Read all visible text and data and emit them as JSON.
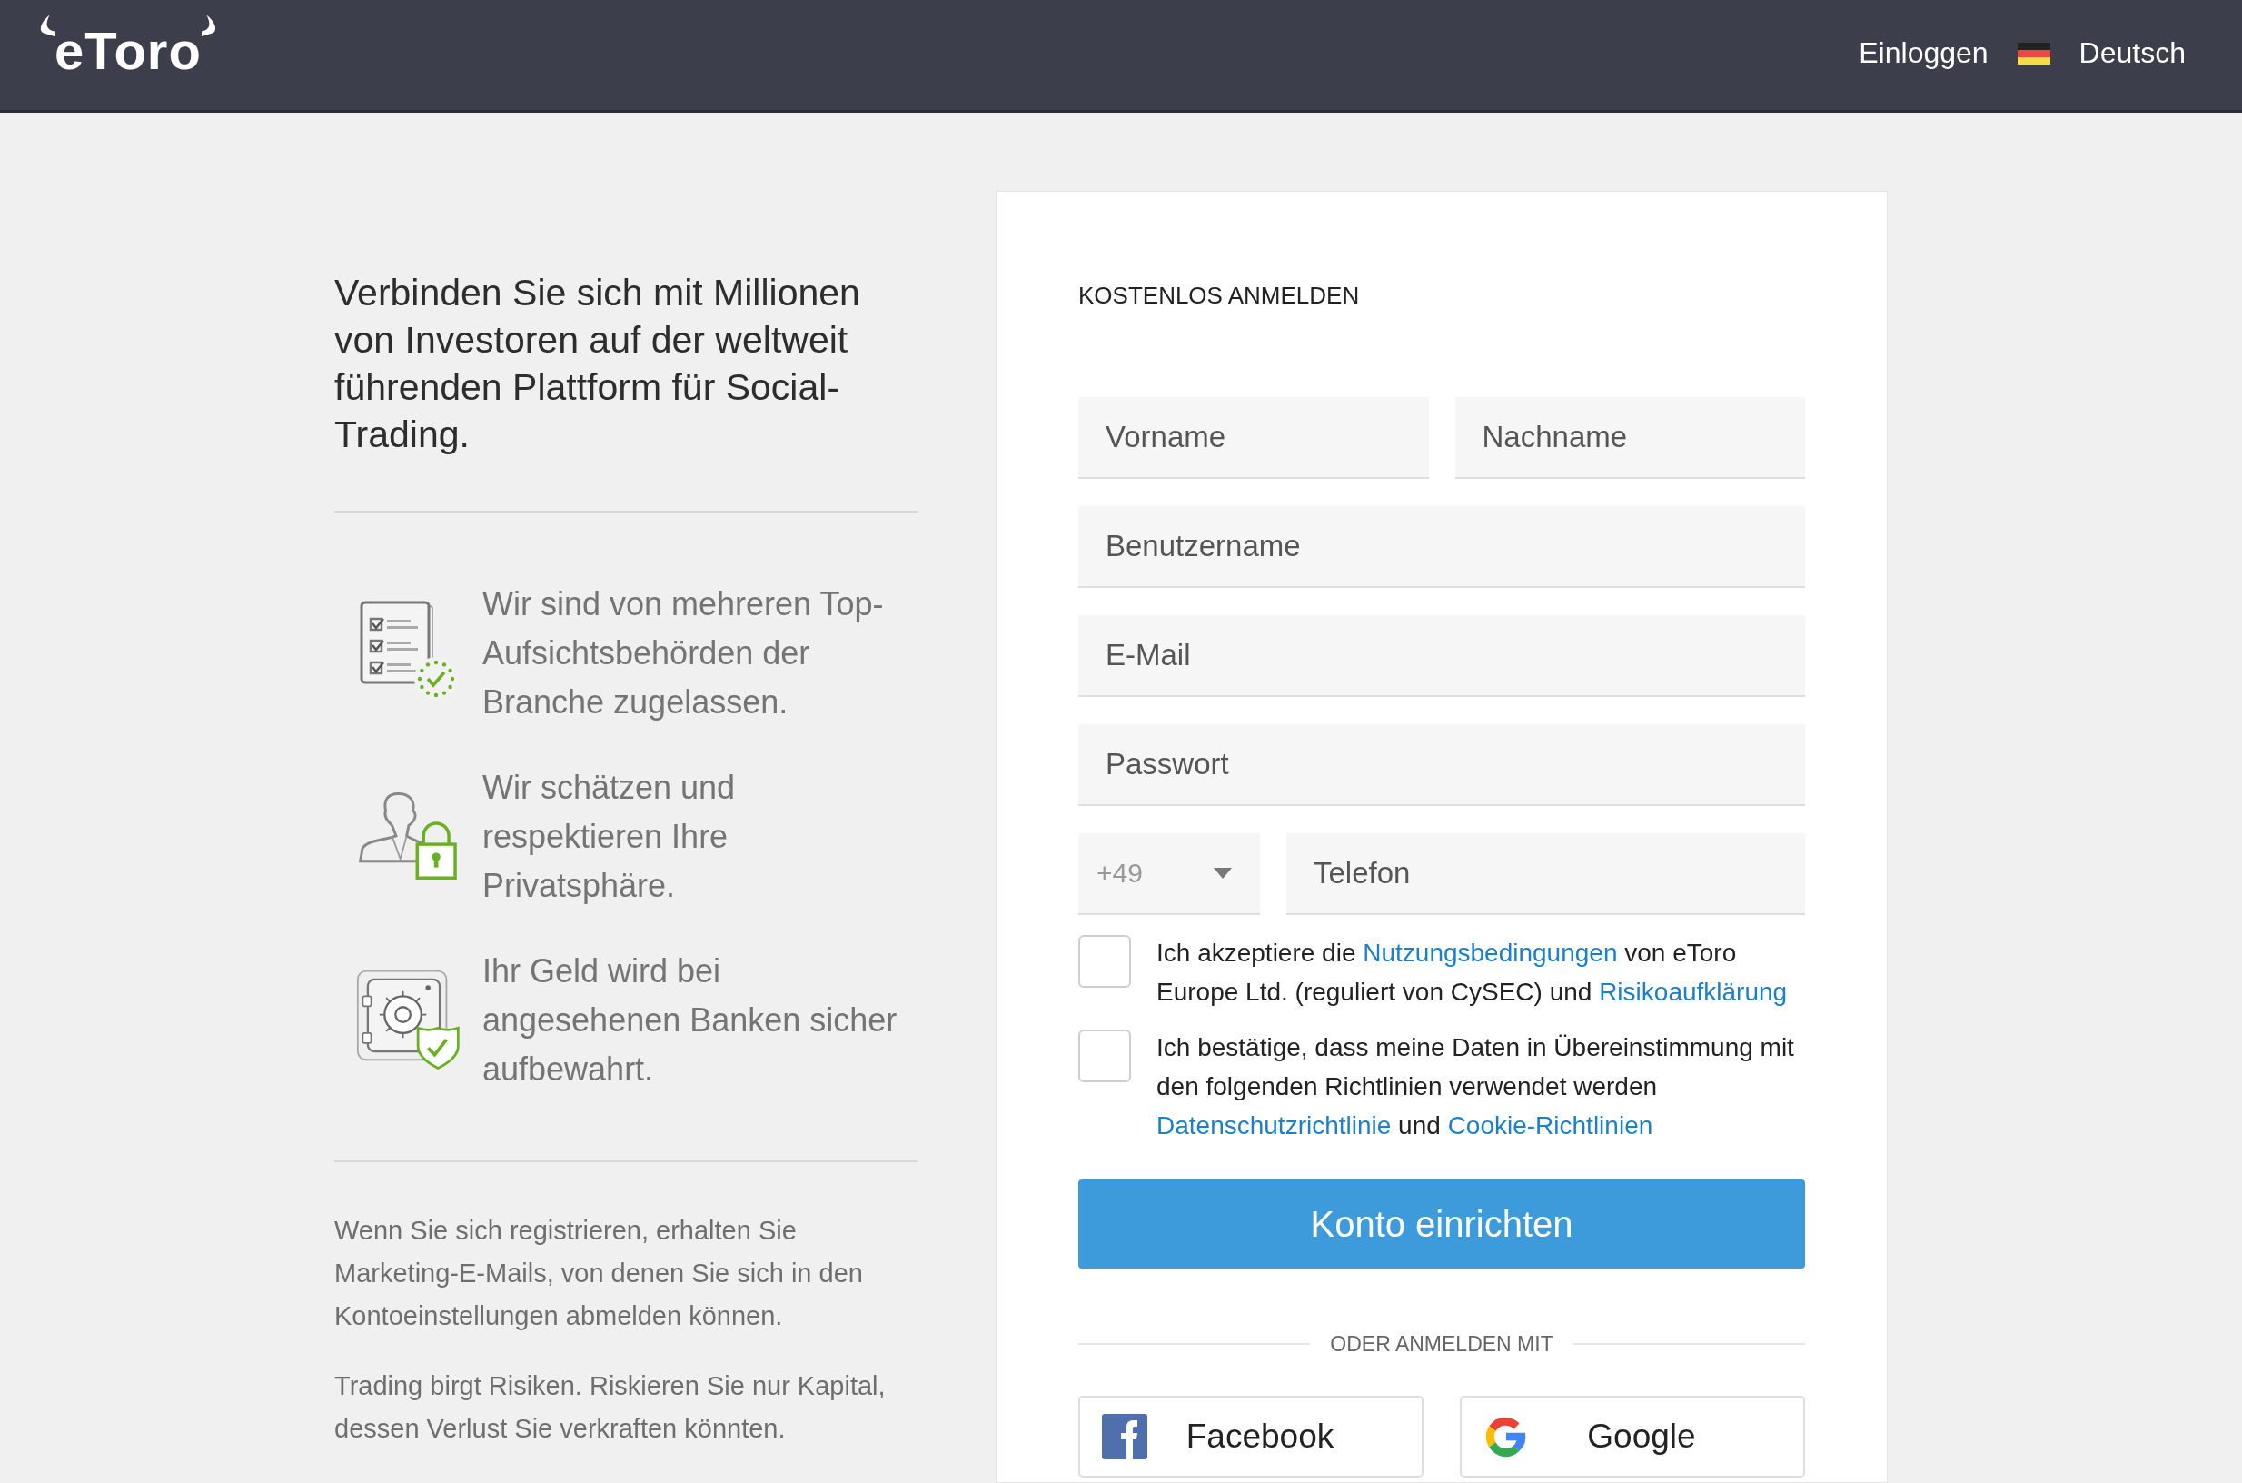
{
  "header": {
    "logo": "eToro",
    "login": "Einloggen",
    "language": "Deutsch"
  },
  "intro": {
    "headline": "Verbinden Sie sich mit Millionen von Investoren auf der weltweit führenden Plattform für Social-Trading.",
    "features": [
      {
        "kind": "license",
        "text": "Wir sind von mehreren Top-Aufsichtsbehörden der Branche zugelassen."
      },
      {
        "kind": "privacy",
        "text": "Wir schätzen und respektieren Ihre Privatsphäre."
      },
      {
        "kind": "safe",
        "text": "Ihr Geld wird bei angesehenen Banken sicher aufbewahrt."
      }
    ],
    "notes": [
      "Wenn Sie sich registrieren, erhalten Sie Marketing-E-Mails, von denen Sie sich in den Kontoeinstellungen abmelden können.",
      "Trading birgt Risiken. Riskieren Sie nur Kapital, dessen Verlust Sie verkraften könnten."
    ]
  },
  "form": {
    "title": "KOSTENLOS ANMELDEN",
    "rows": [
      [
        {
          "kind": "text",
          "placeholder": "Vorname"
        },
        {
          "kind": "text",
          "placeholder": "Nachname"
        }
      ],
      [
        {
          "kind": "text",
          "placeholder": "Benutzername"
        }
      ],
      [
        {
          "kind": "text",
          "placeholder": "E-Mail"
        }
      ],
      [
        {
          "kind": "text",
          "placeholder": "Passwort"
        }
      ],
      [
        {
          "kind": "select",
          "value": "+49"
        },
        {
          "kind": "text",
          "placeholder": "Telefon"
        }
      ]
    ],
    "consents": [
      {
        "checked": false,
        "parts": [
          {
            "kind": "text",
            "text": "Ich akzeptiere die "
          },
          {
            "kind": "link",
            "text": "Nutzungsbedingungen"
          },
          {
            "kind": "text",
            "text": " von eToro Europe Ltd. (reguliert von CySEC) und "
          },
          {
            "kind": "link",
            "text": "Risikoaufklärung"
          }
        ]
      },
      {
        "checked": false,
        "parts": [
          {
            "kind": "text",
            "text": "Ich bestätige, dass meine Daten in Übereinstimmung mit den folgenden Richtlinien verwendet werden "
          },
          {
            "kind": "link",
            "text": "Datenschutzrichtlinie"
          },
          {
            "kind": "text",
            "text": " und "
          },
          {
            "kind": "link",
            "text": "Cookie-Richtlinien"
          }
        ]
      }
    ],
    "submit": "Konto einrichten",
    "divider": "ODER ANMELDEN MIT",
    "social": [
      {
        "kind": "facebook",
        "label": "Facebook"
      },
      {
        "kind": "google",
        "label": "Google"
      }
    ]
  }
}
